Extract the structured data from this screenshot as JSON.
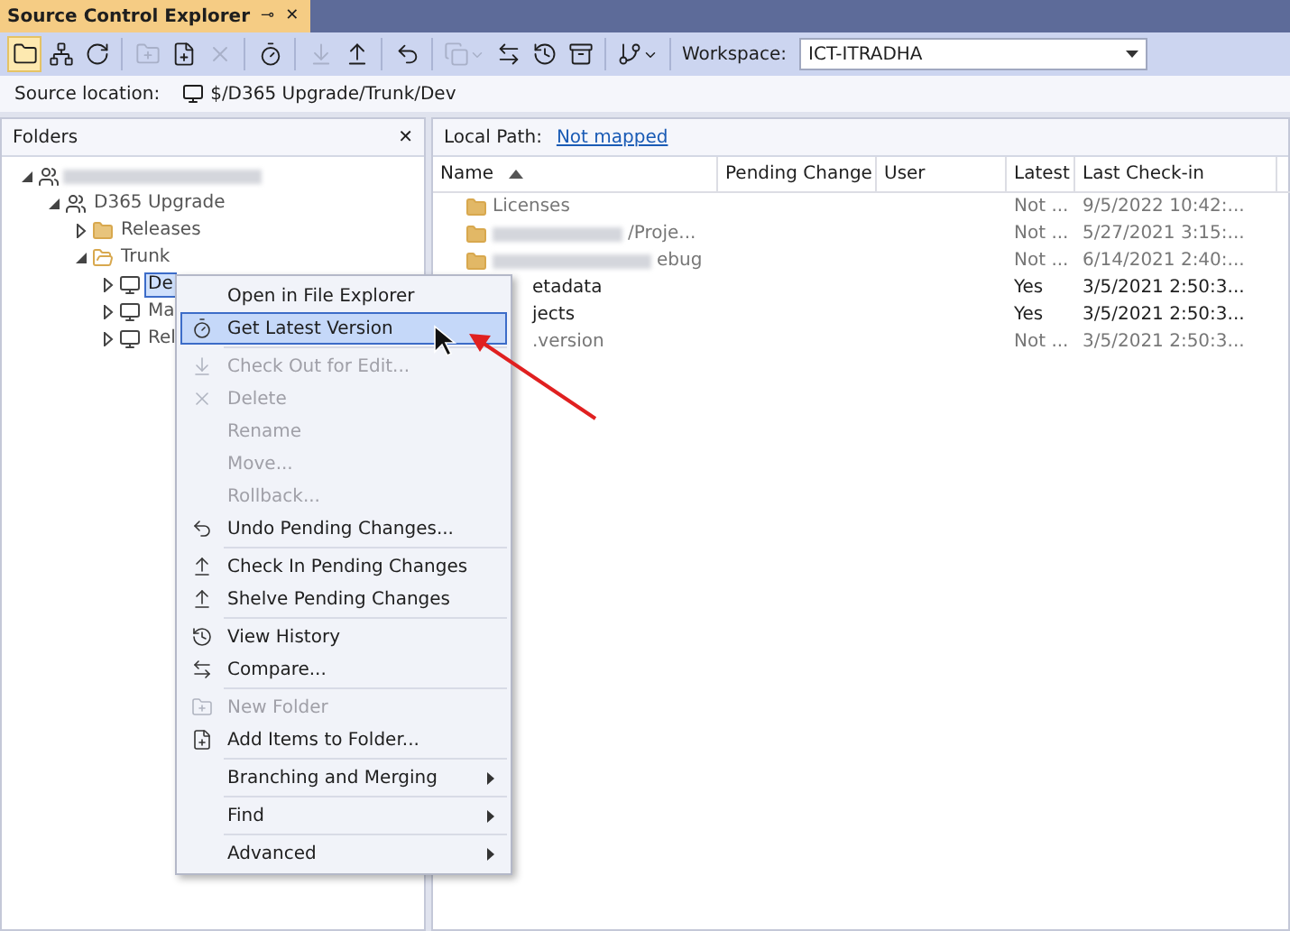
{
  "tab": {
    "title": "Source Control Explorer",
    "pin": "⊸",
    "close": "✕"
  },
  "toolbar": {
    "items": [
      {
        "kind": "button",
        "selected": true,
        "disabled": false
      },
      {
        "kind": "button",
        "selected": false,
        "disabled": false
      },
      {
        "kind": "button",
        "selected": false,
        "disabled": false
      },
      {
        "kind": "separator"
      },
      {
        "kind": "button",
        "selected": false,
        "disabled": true
      },
      {
        "kind": "button",
        "selected": false,
        "disabled": false
      },
      {
        "kind": "button",
        "selected": false,
        "disabled": true
      },
      {
        "kind": "separator"
      },
      {
        "kind": "button",
        "selected": false,
        "disabled": false
      },
      {
        "kind": "separator"
      },
      {
        "kind": "button",
        "selected": false,
        "disabled": true
      },
      {
        "kind": "button",
        "selected": false,
        "disabled": false
      },
      {
        "kind": "separator"
      },
      {
        "kind": "button",
        "selected": false,
        "disabled": false
      },
      {
        "kind": "separator"
      },
      {
        "kind": "dropdown",
        "selected": false,
        "disabled": true
      },
      {
        "kind": "button",
        "selected": false,
        "disabled": false
      },
      {
        "kind": "button",
        "selected": false,
        "disabled": false
      },
      {
        "kind": "button",
        "selected": false,
        "disabled": false
      },
      {
        "kind": "separator"
      },
      {
        "kind": "dropdown",
        "selected": false,
        "disabled": false
      },
      {
        "kind": "separator"
      }
    ],
    "workspace_label": "Workspace:",
    "workspace_value": "ICT-ITRADHA"
  },
  "source_location": {
    "label": "Source location:",
    "path": "$/D365 Upgrade/Trunk/Dev"
  },
  "folders": {
    "title": "Folders",
    "close": "✕",
    "tree": [
      {
        "kind": "team",
        "redacted": true,
        "expanded": true,
        "children": [
          {
            "kind": "team",
            "label": "D365 Upgrade",
            "expanded": true,
            "children": [
              {
                "kind": "folder",
                "label": "Releases",
                "expanded": false
              },
              {
                "kind": "folder",
                "label": "Trunk",
                "expanded": true,
                "children": [
                  {
                    "kind": "branch",
                    "label": "De",
                    "expanded": false,
                    "selected": true
                  },
                  {
                    "kind": "branch",
                    "label": "Ma",
                    "expanded": false,
                    "selected": false
                  },
                  {
                    "kind": "branch",
                    "label": "Rel",
                    "expanded": false,
                    "selected": false
                  }
                ]
              }
            ]
          }
        ]
      }
    ]
  },
  "local_path": {
    "label": "Local Path:",
    "link": "Not mapped"
  },
  "table": {
    "columns": [
      "Name",
      "Pending Change",
      "User",
      "Latest",
      "Last Check-in"
    ],
    "rows": [
      {
        "kind": "folder",
        "name": "Licenses",
        "latest": "Not ...",
        "checkin": "9/5/2022 10:42:...",
        "current": false
      },
      {
        "kind": "folder",
        "redacted": true,
        "name": "/Proje...",
        "latest": "Not ...",
        "checkin": "5/27/2021 3:15:...",
        "current": false
      },
      {
        "kind": "folder",
        "redacted": true,
        "name": "ebug",
        "latest": "Not ...",
        "checkin": "6/14/2021 2:40:...",
        "current": false
      },
      {
        "kind": "covered",
        "name": "etadata",
        "latest": "Yes",
        "checkin": "3/5/2021 2:50:3...",
        "current": true
      },
      {
        "kind": "covered",
        "name": "jects",
        "latest": "Yes",
        "checkin": "3/5/2021 2:50:3...",
        "current": true
      },
      {
        "kind": "covered",
        "name": ".version",
        "latest": "Not ...",
        "checkin": "3/5/2021 2:50:3...",
        "current": false
      }
    ]
  },
  "context_menu": [
    {
      "kind": "item",
      "label": "Open in File Explorer",
      "disabled": false,
      "selected": false,
      "submenu": false
    },
    {
      "kind": "item",
      "label": "Get Latest Version",
      "disabled": false,
      "selected": true,
      "submenu": false
    },
    {
      "kind": "separator"
    },
    {
      "kind": "item",
      "label": "Check Out for Edit...",
      "disabled": true,
      "selected": false,
      "submenu": false
    },
    {
      "kind": "item",
      "label": "Delete",
      "disabled": true,
      "selected": false,
      "submenu": false
    },
    {
      "kind": "item",
      "label": "Rename",
      "disabled": true,
      "selected": false,
      "submenu": false
    },
    {
      "kind": "item",
      "label": "Move...",
      "disabled": true,
      "selected": false,
      "submenu": false
    },
    {
      "kind": "item",
      "label": "Rollback...",
      "disabled": true,
      "selected": false,
      "submenu": false
    },
    {
      "kind": "item",
      "label": "Undo Pending Changes...",
      "disabled": false,
      "selected": false,
      "submenu": false
    },
    {
      "kind": "separator"
    },
    {
      "kind": "item",
      "label": "Check In Pending Changes",
      "disabled": false,
      "selected": false,
      "submenu": false
    },
    {
      "kind": "item",
      "label": "Shelve Pending Changes",
      "disabled": false,
      "selected": false,
      "submenu": false
    },
    {
      "kind": "separator"
    },
    {
      "kind": "item",
      "label": "View History",
      "disabled": false,
      "selected": false,
      "submenu": false
    },
    {
      "kind": "item",
      "label": "Compare...",
      "disabled": false,
      "selected": false,
      "submenu": false
    },
    {
      "kind": "separator"
    },
    {
      "kind": "item",
      "label": "New Folder",
      "disabled": true,
      "selected": false,
      "submenu": false
    },
    {
      "kind": "item",
      "label": "Add Items to Folder...",
      "disabled": false,
      "selected": false,
      "submenu": false
    },
    {
      "kind": "separator"
    },
    {
      "kind": "item",
      "label": "Branching and Merging",
      "disabled": false,
      "selected": false,
      "submenu": true
    },
    {
      "kind": "separator"
    },
    {
      "kind": "item",
      "label": "Find",
      "disabled": false,
      "selected": false,
      "submenu": true
    },
    {
      "kind": "separator"
    },
    {
      "kind": "item",
      "label": "Advanced",
      "disabled": false,
      "selected": false,
      "submenu": true
    }
  ]
}
